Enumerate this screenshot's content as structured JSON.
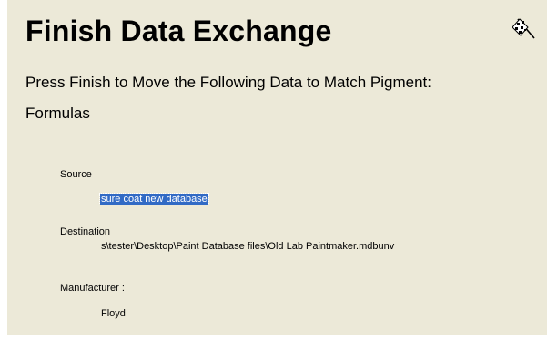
{
  "header": {
    "title": "Finish Data Exchange",
    "icon": "checkered-flag-icon"
  },
  "message": {
    "line1": "Press Finish to Move the Following Data to Match Pigment:",
    "line2": "Formulas"
  },
  "fields": {
    "source_label": "Source",
    "source_value": "sure coat new database",
    "destination_label": "Destination",
    "destination_value": "s\\tester\\Desktop\\Paint Database files\\Old Lab Paintmaker.mdbunv",
    "manufacturer_label": "Manufacturer :",
    "manufacturer_value": "Floyd"
  },
  "colors": {
    "panel_background": "#ece9d8",
    "selection_highlight": "#316ac5"
  }
}
